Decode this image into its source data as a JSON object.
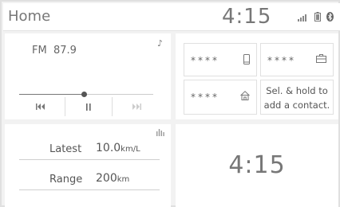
{
  "header": {
    "title": "Home",
    "clock": "4:15"
  },
  "icons": {
    "signal": "signal-bars-icon",
    "phone_battery": "battery-icon",
    "bluetooth": "bluetooth-icon"
  },
  "radio": {
    "band": "FM",
    "frequency": "87.9",
    "progress_fraction": 0.48,
    "controls": [
      "previous",
      "pause",
      "next"
    ]
  },
  "contacts": [
    {
      "masked_name": "****",
      "icon": "mobile-phone-icon"
    },
    {
      "masked_name": "****",
      "icon": "briefcase-icon"
    },
    {
      "masked_name": "****",
      "icon": "home-icon"
    }
  ],
  "contact_hint": {
    "line1": "Sel. & hold to",
    "line2": "add a contact."
  },
  "trip": {
    "latest": {
      "label": "Latest",
      "value": "10.0",
      "unit": "km/L"
    },
    "range": {
      "label": "Range",
      "value": "200",
      "unit": "km"
    }
  },
  "clock_panel": {
    "time": "4:15"
  }
}
